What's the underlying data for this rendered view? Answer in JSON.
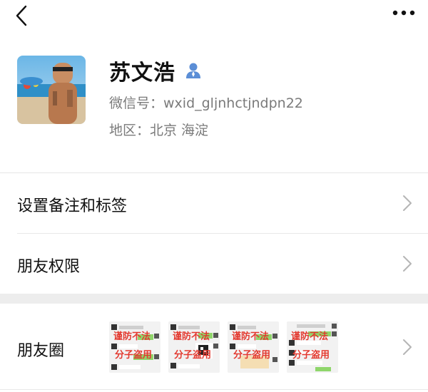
{
  "profile": {
    "name": "苏文浩",
    "wxid_line": "微信号：wxid_gljnhctjndpn22",
    "region_line": "地区：北京  海淀"
  },
  "menu": {
    "remark_label": "设置备注和标签",
    "permissions_label": "朋友权限",
    "moments_label": "朋友圈"
  },
  "moments": {
    "thumbnails": [
      {
        "watermark_top": "谨防不法",
        "watermark_bottom": "分子盗用"
      },
      {
        "watermark_top": "谨防不法",
        "watermark_bottom": "分子盗用"
      },
      {
        "watermark_top": "谨防不法",
        "watermark_bottom": "分子盗用"
      },
      {
        "watermark_top": "谨防不法",
        "watermark_bottom": "分子盗用"
      }
    ]
  },
  "icons": {
    "back": "chevron-left-icon",
    "more": "more-dots-icon",
    "verified": "user-badge-icon",
    "row_arrow": "chevron-right-icon"
  },
  "colors": {
    "accent_blue": "#5b8ed6",
    "secondary_text": "#7a7a7a",
    "watermark_red": "#e3392f",
    "chat_green": "#8fd66b"
  }
}
